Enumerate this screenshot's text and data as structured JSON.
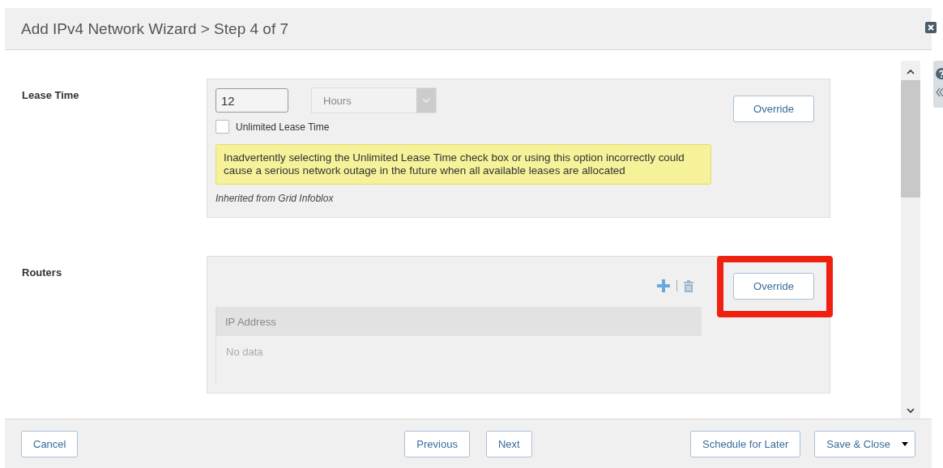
{
  "dialog": {
    "title": "Add IPv4 Network Wizard > Step 4 of 7"
  },
  "sections": [
    {
      "kind": "lease",
      "label": "Lease Time",
      "value": "12",
      "unit": "Hours",
      "unit_disabled": true,
      "unlimited": {
        "label": "Unlimited Lease Time",
        "checked": false
      },
      "warning": "Inadvertently selecting the Unlimited Lease Time check box or using this option incorrectly could cause a serious network outage in the future when all available leases are allocated",
      "inherited": "Inherited from Grid Infoblox",
      "override": "Override",
      "highlighted": false
    },
    {
      "kind": "table",
      "label": "Routers",
      "columns": [
        "IP Address"
      ],
      "empty": "No data",
      "override": "Override",
      "highlighted": true
    }
  ],
  "footer": {
    "left": [
      "Cancel"
    ],
    "middle": [
      "Previous",
      "Next"
    ],
    "right": [
      {
        "label": "Schedule for Later",
        "kind": "plain"
      },
      {
        "label": "Save & Close",
        "kind": "split"
      }
    ]
  }
}
